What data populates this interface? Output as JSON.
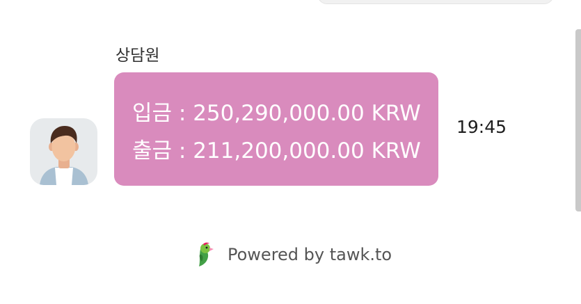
{
  "chat": {
    "agent_name": "상담원",
    "message": {
      "line1": "입금 : 250,290,000.00 KRW",
      "line2": "출금 : 211,200,000.00 KRW"
    },
    "time": "19:45"
  },
  "footer": {
    "powered_by": "Powered by tawk.to"
  },
  "colors": {
    "bubble": "#d98bbd",
    "avatar_bg": "#e7eaec"
  },
  "icons": {
    "avatar": "agent-avatar-icon",
    "brand": "tawk-parrot-logo-icon"
  }
}
